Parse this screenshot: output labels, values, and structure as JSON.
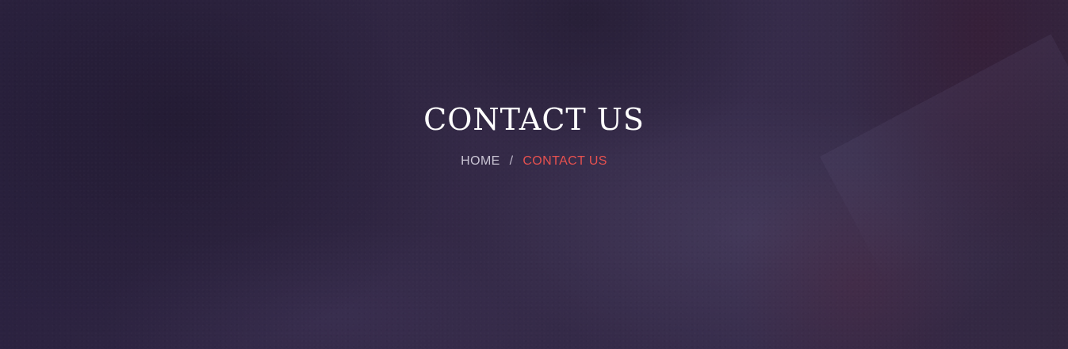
{
  "hero": {
    "title": "CONTACT US"
  },
  "breadcrumb": {
    "home_label": "HOME",
    "separator": "/",
    "current_label": "CONTACT US"
  },
  "colors": {
    "background": "#332945",
    "title": "#ffffff",
    "breadcrumb_link": "#c9c4d3",
    "breadcrumb_current": "#e7514f"
  }
}
